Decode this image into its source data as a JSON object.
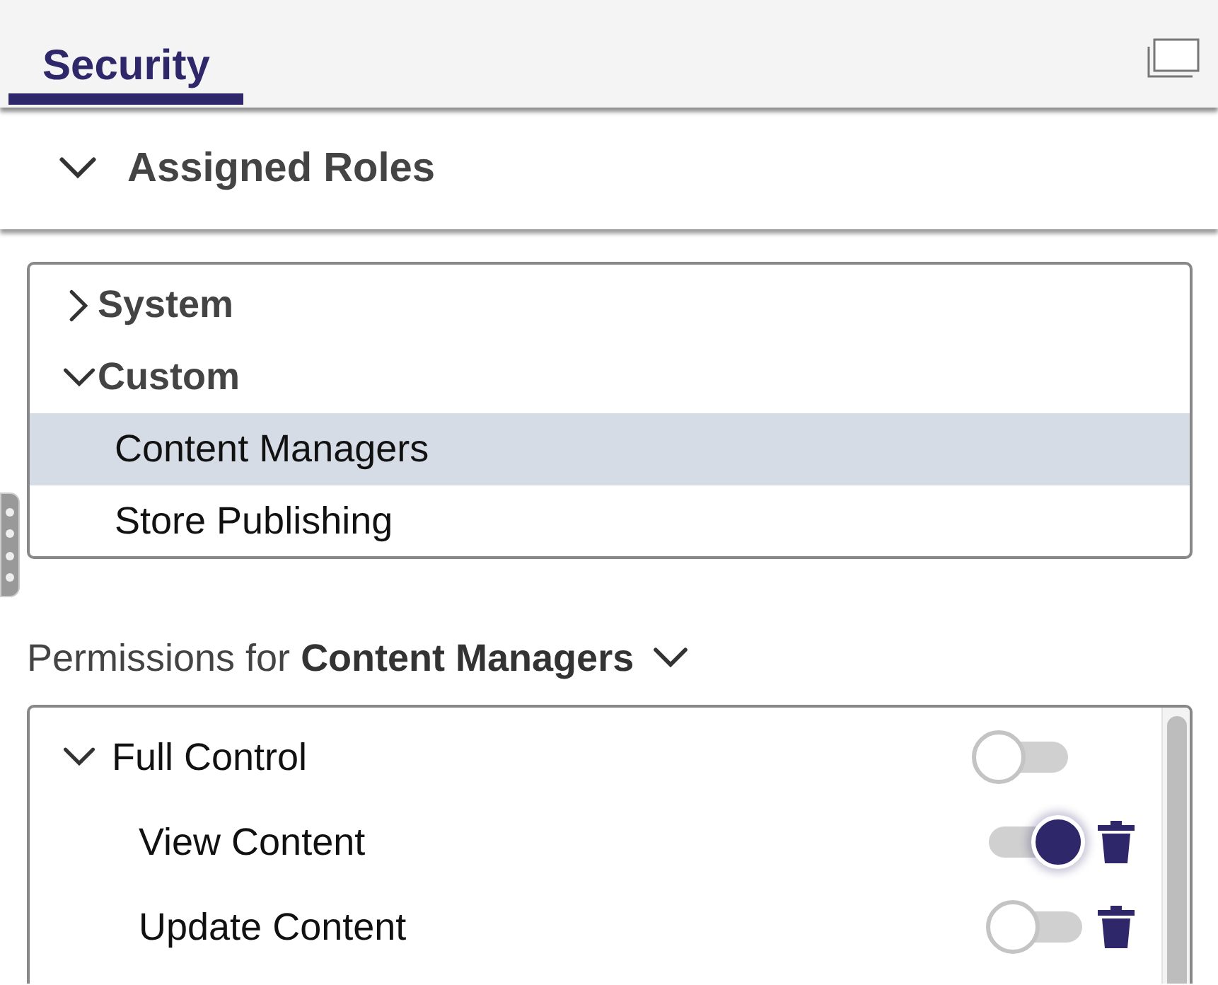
{
  "tabs": [
    {
      "label": "Security",
      "selected": true
    }
  ],
  "section": {
    "title": "Assigned Roles",
    "expanded": true
  },
  "roles": [
    {
      "label": "System",
      "expanded": false
    },
    {
      "label": "Custom",
      "expanded": true,
      "children": [
        {
          "label": "Content Managers",
          "selected": true
        },
        {
          "label": "Store Publishing",
          "selected": false
        }
      ]
    }
  ],
  "permissions": {
    "title": "Permissions for **Content Managers**",
    "items": [
      {
        "label": "Full Control",
        "expanded": true,
        "on": false,
        "deletable": false,
        "children": [
          {
            "label": "View Content",
            "on": true,
            "deletable": true
          },
          {
            "label": "Update Content",
            "on": false,
            "deletable": true
          }
        ]
      }
    ]
  }
}
